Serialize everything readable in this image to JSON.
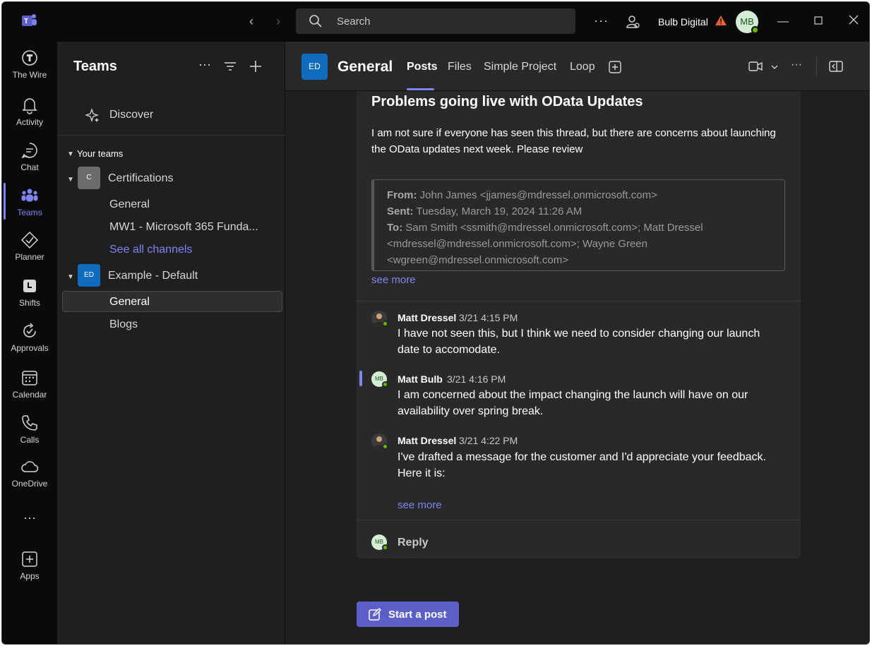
{
  "titlebar": {
    "search_placeholder": "Search",
    "more": "···",
    "org_name": "Bulb Digital",
    "avatar_initials": "MB"
  },
  "rail": [
    {
      "label": "The Wire",
      "icon": "the-wire-icon"
    },
    {
      "label": "Activity",
      "icon": "bell-icon"
    },
    {
      "label": "Chat",
      "icon": "chat-icon"
    },
    {
      "label": "Teams",
      "icon": "teams-icon",
      "active": true
    },
    {
      "label": "Planner",
      "icon": "planner-icon"
    },
    {
      "label": "Shifts",
      "icon": "shifts-icon"
    },
    {
      "label": "Approvals",
      "icon": "approvals-icon"
    },
    {
      "label": "Calendar",
      "icon": "calendar-icon"
    },
    {
      "label": "Calls",
      "icon": "phone-icon"
    },
    {
      "label": "OneDrive",
      "icon": "cloud-icon"
    },
    {
      "label": "Apps",
      "icon": "apps-icon"
    }
  ],
  "rail_more": "···",
  "panel": {
    "title": "Teams",
    "discover": "Discover",
    "section": "Your teams",
    "teams": [
      {
        "badge": "C",
        "name": "Certifications",
        "color": "#6b6b6b",
        "channels": [
          "General",
          "MW1 - Microsoft 365 Funda..."
        ],
        "see_all": "See all channels"
      },
      {
        "badge": "ED",
        "name": "Example - Default",
        "color": "#0f6cbd",
        "channels": [
          "General",
          "Blogs"
        ]
      }
    ]
  },
  "header": {
    "badge": "ED",
    "channel": "General",
    "tabs": [
      "Posts",
      "Files",
      "Simple Project",
      "Loop"
    ],
    "active_tab": "Posts"
  },
  "post": {
    "title": "Problems going live with OData Updates",
    "body": "I am not sure if everyone has seen this thread, but there are concerns about launching the OData updates next week. Please review",
    "quote": {
      "from_label": "From:",
      "from": "John James <jjames@mdressel.onmicrosoft.com>",
      "sent_label": "Sent:",
      "sent": "Tuesday, March 19, 2024 11:26 AM",
      "to_label": "To:",
      "to": "Sam Smith <ssmith@mdressel.onmicrosoft.com>; Matt Dressel <mdressel@mdressel.onmicrosoft.com>; Wayne Green <wgreen@mdressel.onmicrosoft.com>"
    },
    "see_more": "see more"
  },
  "replies": [
    {
      "name": "Matt Dressel",
      "time": "3/21 4:15 PM",
      "text": "I have not seen this, but I think we need to consider changing our launch date to accomodate."
    },
    {
      "name": "Matt Bulb",
      "time": "3/21 4:16 PM",
      "initials": "MB",
      "text": "I am concerned about the impact changing the launch will have on our availability over spring break."
    },
    {
      "name": "Matt Dressel",
      "time": "3/21 4:22 PM",
      "text": "I've drafted a message for the customer and I'd appreciate your feedback. Here it is:"
    }
  ],
  "replies_see_more": "see more",
  "reply_label": "Reply",
  "reply_initials": "MB",
  "start_post": "Start a post",
  "colors": {
    "accent": "#7f85f5",
    "brand": "#5b5fc7",
    "presence": "#6bb700",
    "warning": "#e8603a"
  }
}
